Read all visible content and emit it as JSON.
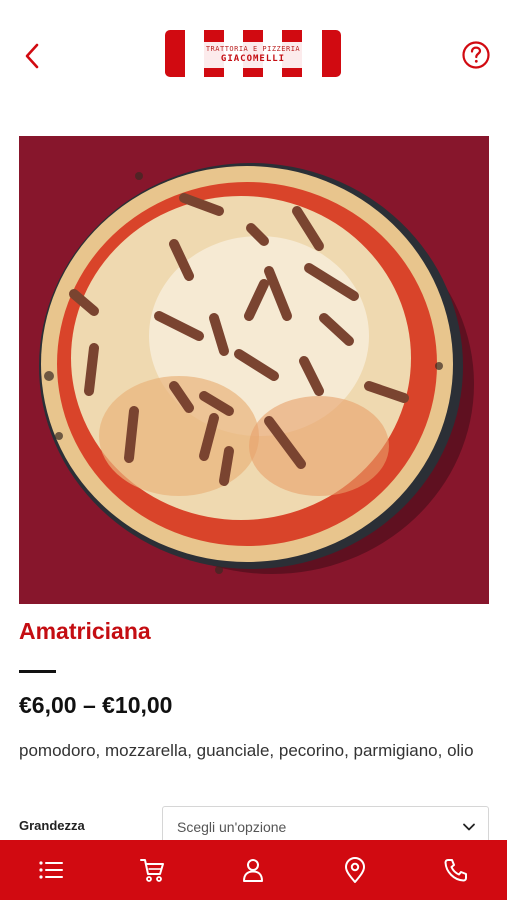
{
  "brand": {
    "line1": "TRATTORIA E PIZZERIA",
    "line2": "GIACOMELLI"
  },
  "colors": {
    "accent": "#d10a11",
    "title": "#c40d12"
  },
  "header": {
    "back_icon": "chevron-left-icon",
    "help_icon": "question-circle-icon"
  },
  "product": {
    "name": "Amatriciana",
    "price": "€6,00 – €10,00",
    "ingredients": "pomodoro, mozzarella, guanciale, pecorino, parmigiano, olio"
  },
  "options": {
    "size_label": "Grandezza",
    "size_selected": "Scegli un'opzione"
  },
  "nav": {
    "items": [
      {
        "icon": "list-icon"
      },
      {
        "icon": "cart-icon"
      },
      {
        "icon": "user-icon"
      },
      {
        "icon": "map-pin-icon"
      },
      {
        "icon": "phone-icon"
      }
    ]
  }
}
